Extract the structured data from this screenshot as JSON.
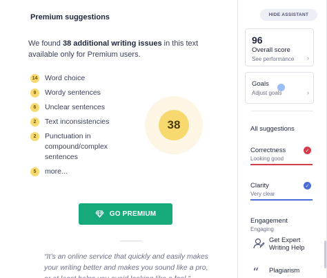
{
  "premium": {
    "title": "Premium suggestions",
    "intro_pre": "We found ",
    "intro_bold": "38 additional writing issues",
    "intro_post": " in this text available only for Premium users.",
    "issues": [
      {
        "count": "14",
        "label": "Word choice"
      },
      {
        "count": "9",
        "label": "Wordy sentences"
      },
      {
        "count": "6",
        "label": "Unclear sentences"
      },
      {
        "count": "2",
        "label": "Text inconsistencies"
      },
      {
        "count": "2",
        "label": "Punctuation in compound/complex sentences"
      },
      {
        "count": "5",
        "label": "more..."
      }
    ],
    "total": "38",
    "cta_label": "GO PREMIUM",
    "quote": "“It’s an online service that quickly and easily makes your writing better and makes you sound like a pro, or at least helps you avoid looking like a fool.”"
  },
  "assistant": {
    "hide_label": "HIDE ASSISTANT",
    "score": {
      "value": "96",
      "label": "Overall score",
      "sub": "See performance"
    },
    "goals": {
      "label": "Goals",
      "sub": "Adjust goals"
    },
    "all_suggestions": "All suggestions",
    "categories": [
      {
        "name": "Correctness",
        "desc": "Looking good",
        "color": "#d63b4a"
      },
      {
        "name": "Clarity",
        "desc": "Very clear",
        "color": "#4a6fd8"
      },
      {
        "name": "Engagement",
        "desc": "Engaging",
        "color": "#15a97c"
      }
    ],
    "links": [
      {
        "label": "Get Expert Writing Help",
        "icon": "expert-person-icon"
      },
      {
        "label": "Plagiarism",
        "icon": "quote-marks-icon"
      }
    ]
  },
  "colors": {
    "accent_green": "#15a97c",
    "badge_yellow": "#f7d96f",
    "correctness": "#d63b4a",
    "clarity": "#4a6fd8"
  }
}
